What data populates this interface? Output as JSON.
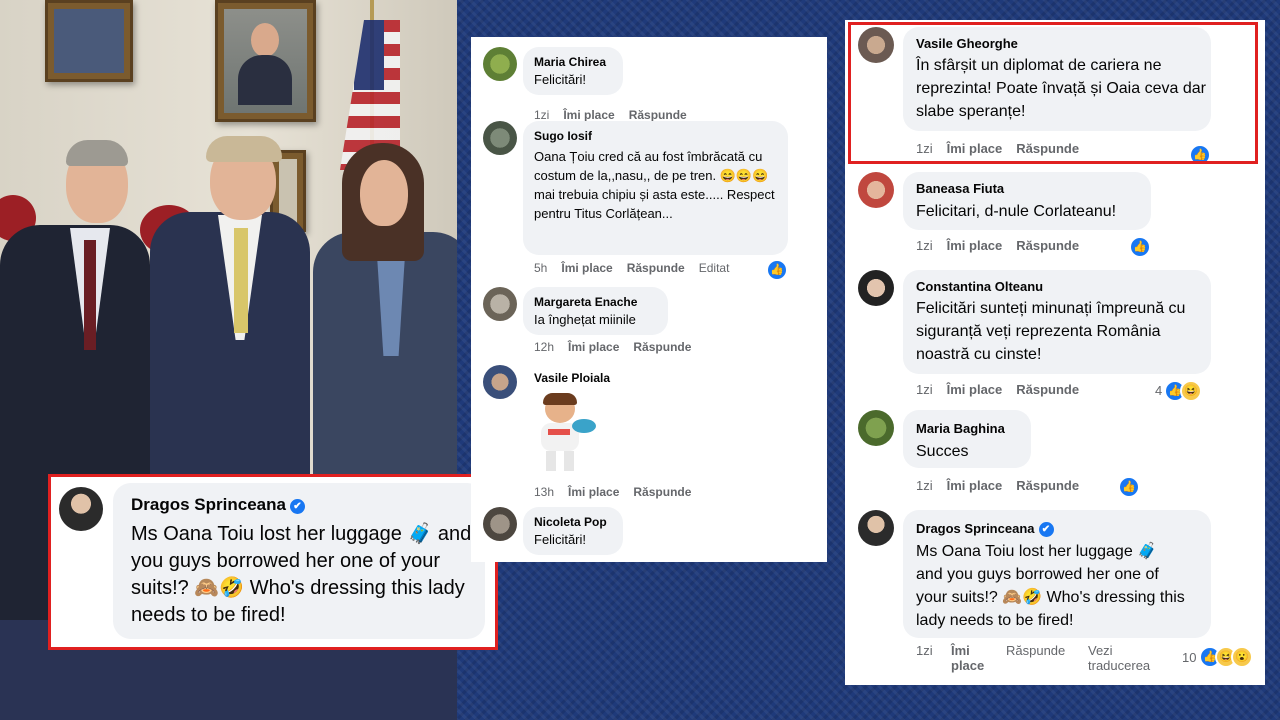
{
  "photo_quote": {
    "name": "Dragos Sprinceana",
    "verified": "✔",
    "text": "Ms Oana Toiu lost her luggage 🧳 and you guys borrowed her one of your suits!? 🙈🤣 Who's dressing this lady needs to be fired!"
  },
  "middle_panel": {
    "comments": [
      {
        "name": "Maria Chirea",
        "text": "Felicitări!",
        "time": "1zi",
        "like_label": "Îmi place",
        "reply_label": "Răspunde",
        "extra": "",
        "reactions": ""
      },
      {
        "name": "Sugo Iosif",
        "text": "Oana Țoiu cred că au fost îmbrăcată cu costum de la,,nasu,, de pe tren. 😄😄😄 mai trebuia chipiu și asta este..... Respect pentru Titus Corlățean...",
        "time": "5h",
        "like_label": "Îmi place",
        "reply_label": "Răspunde",
        "extra": "Editat",
        "reactions": "like"
      },
      {
        "name": "Margareta Enache",
        "text": "Ia înghețat miinile",
        "time": "12h",
        "like_label": "Îmi place",
        "reply_label": "Răspunde",
        "extra": "",
        "reactions": ""
      },
      {
        "name": "Vasile Ploiala",
        "text": "",
        "time": "13h",
        "like_label": "Îmi place",
        "reply_label": "Răspunde",
        "extra": "",
        "reactions": "",
        "sticker": "sticker-cartoon"
      },
      {
        "name": "Nicoleta Pop",
        "text": "Felicitări!",
        "time": "",
        "like_label": "",
        "reply_label": "",
        "extra": "",
        "reactions": ""
      }
    ]
  },
  "right_panel": {
    "comments": [
      {
        "name": "Vasile Gheorghe",
        "text": "În sfârșit un diplomat de cariera ne reprezinta! Poate învață și Oaia ceva dar slabe speranțe!",
        "time": "1zi",
        "like_label": "Îmi place",
        "reply_label": "Răspunde",
        "count": "",
        "reactions": "like"
      },
      {
        "name": "Baneasa Fiuta",
        "text": "Felicitari, d-nule Corlateanu!",
        "time": "1zi",
        "like_label": "Îmi place",
        "reply_label": "Răspunde",
        "count": "",
        "reactions": "like"
      },
      {
        "name": "Constantina Olteanu",
        "text": "Felicitări sunteți minunați împreună cu siguranță veți reprezenta România noastră cu cinste!",
        "time": "1zi",
        "like_label": "Îmi place",
        "reply_label": "Răspunde",
        "count": "4",
        "reactions": "like-haha"
      },
      {
        "name": "Maria Baghina",
        "text": "Succes",
        "time": "1zi",
        "like_label": "Îmi place",
        "reply_label": "Răspunde",
        "count": "",
        "reactions": "like"
      },
      {
        "name": "Dragos Sprinceana",
        "text": "Ms Oana Toiu lost her luggage 🧳 and you guys borrowed her one of your suits!? 🙈🤣 Who's dressing this lady needs to be fired!",
        "time": "1zi",
        "like_label": "Îmi place",
        "reply_label": "Răspunde",
        "translate_label": "Vezi traducerea",
        "count": "10",
        "reactions": "like-haha-wow",
        "verified": "✔"
      }
    ]
  },
  "icons": {
    "like": "👍",
    "haha": "😆",
    "wow": "😮"
  }
}
